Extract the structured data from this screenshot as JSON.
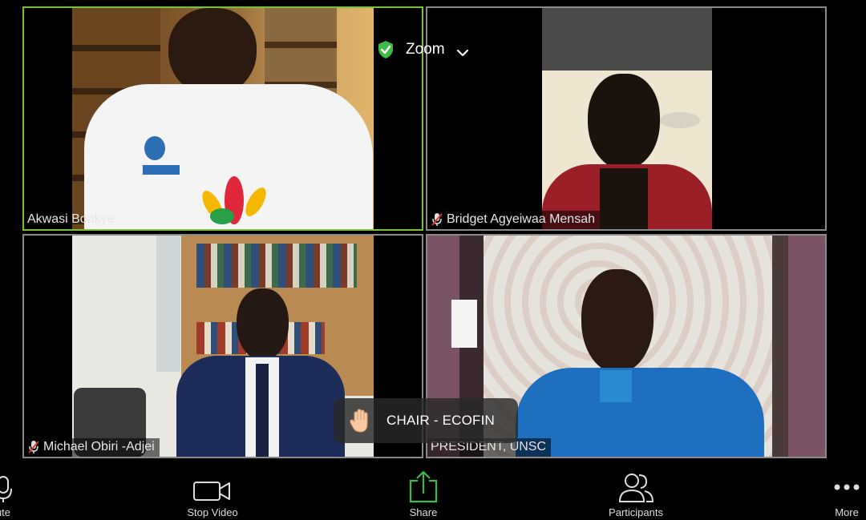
{
  "meeting": {
    "app_name": "Zoom",
    "colors": {
      "active_border": "#7bbf3a",
      "share_green": "#3dbb45",
      "shield_green": "#3dbb45"
    }
  },
  "participants": [
    {
      "name": "Akwasi Boakye",
      "muted": false,
      "active": true
    },
    {
      "name": "Bridget Agyeiwaa Mensah",
      "muted": true,
      "active": false
    },
    {
      "name": "Michael Obiri -Adjei",
      "muted": true,
      "active": false
    },
    {
      "name": "PRESIDENT, UNSC",
      "muted": false,
      "active": false
    }
  ],
  "raised_hand": {
    "label": "CHAIR - ECOFIN",
    "icon": "raised-hand-icon"
  },
  "toolbar": {
    "mute_label": "ute",
    "video_label": "Stop Video",
    "share_label": "Share",
    "participants_label": "Participants",
    "more_label": "More"
  }
}
